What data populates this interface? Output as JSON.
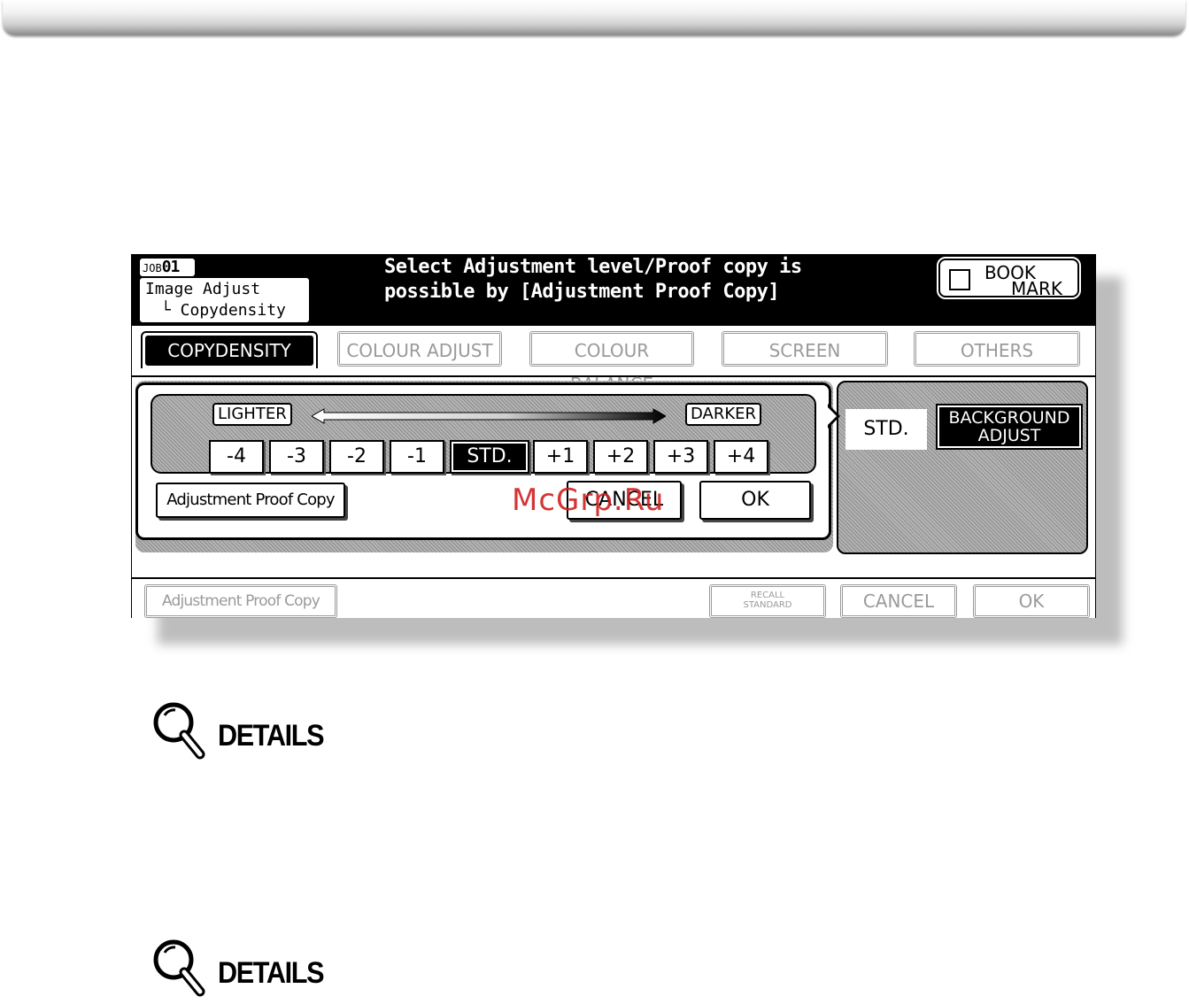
{
  "header": {
    "job_prefix": "JOB",
    "job_number": "01",
    "breadcrumb_title": "Image Adjust",
    "breadcrumb_sub": "└ Copydensity",
    "message_line1": "Select Adjustment level/Proof copy is",
    "message_line2": "possible by [Adjustment Proof Copy]",
    "bookmark_line1": "BOOK",
    "bookmark_line2": "MARK"
  },
  "tabs": [
    {
      "label": "COPYDENSITY",
      "active": true
    },
    {
      "label": "COLOUR ADJUST",
      "active": false
    },
    {
      "label": "COLOUR BALANCE",
      "active": false
    },
    {
      "label": "SCREEN",
      "active": false
    },
    {
      "label": "OTHERS",
      "active": false
    }
  ],
  "density": {
    "lighter_label": "LIGHTER",
    "darker_label": "DARKER",
    "levels": [
      "-4",
      "-3",
      "-2",
      "-1",
      "STD.",
      "+1",
      "+2",
      "+3",
      "+4"
    ],
    "selected": "STD."
  },
  "panel_buttons": {
    "proof": "Adjustment Proof Copy",
    "cancel": "CANCEL",
    "ok": "OK"
  },
  "side": {
    "std": "STD.",
    "background_line1": "BACKGROUND",
    "background_line2": "ADJUST"
  },
  "bottom": {
    "proof": "Adjustment Proof Copy",
    "recall_line1": "RECALL",
    "recall_line2": "STANDARD",
    "cancel": "CANCEL",
    "ok": "OK"
  },
  "watermark": "McGrp.Ru",
  "details": [
    "DETAILS",
    "DETAILS"
  ]
}
